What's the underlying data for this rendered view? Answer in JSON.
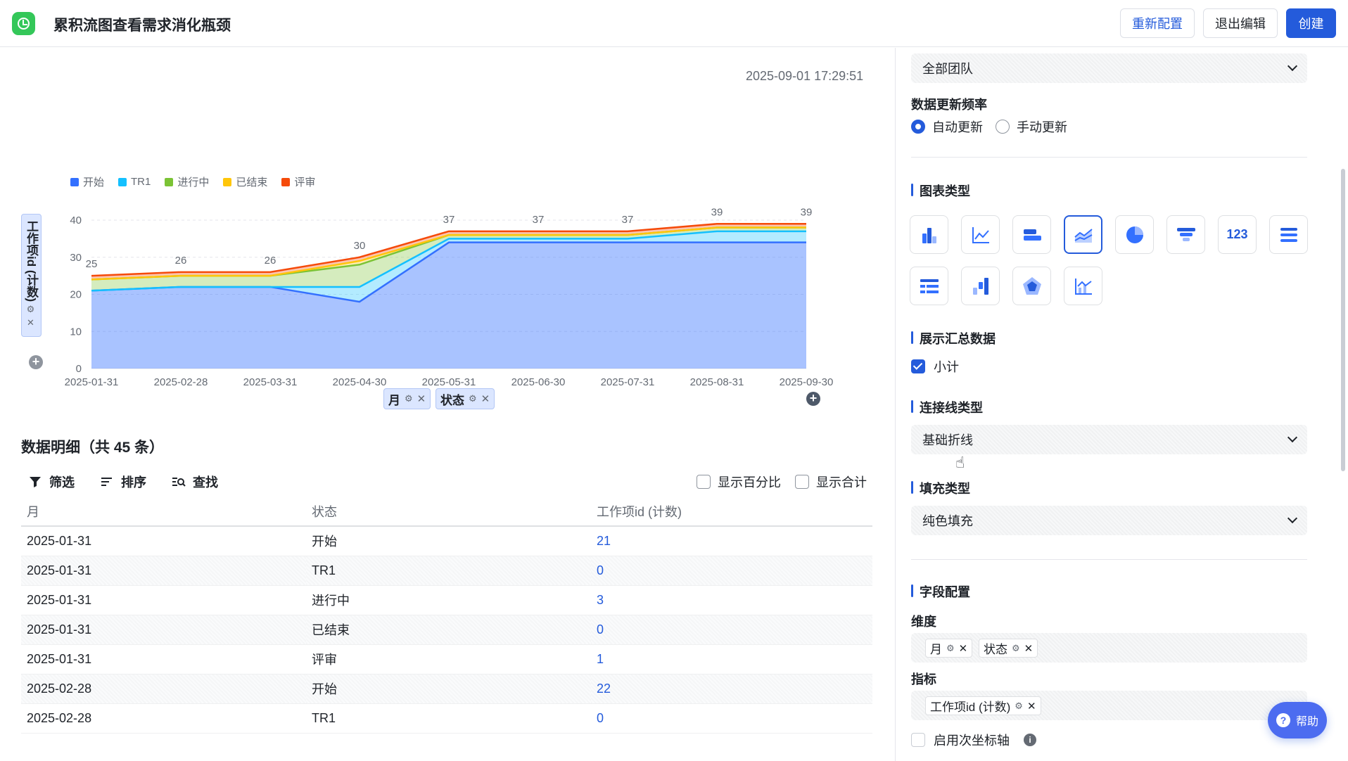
{
  "header": {
    "title": "累积流图查看需求消化瓶颈",
    "reconfig_label": "重新配置",
    "exit_label": "退出编辑",
    "create_label": "创建"
  },
  "main": {
    "timestamp": "2025-09-01 17:29:51",
    "yaxis_chip": "工作项id (计数)",
    "row_chips": [
      "月",
      "状态"
    ],
    "detail_title": "数据明细（共 45 条）",
    "toolbar": {
      "filter": "筛选",
      "sort": "排序",
      "find": "查找"
    },
    "show_percent": "显示百分比",
    "show_total": "显示合计",
    "table": {
      "headers": [
        "月",
        "状态",
        "工作项id (计数)"
      ],
      "rows": [
        [
          "2025-01-31",
          "开始",
          "21"
        ],
        [
          "2025-01-31",
          "TR1",
          "0"
        ],
        [
          "2025-01-31",
          "进行中",
          "3"
        ],
        [
          "2025-01-31",
          "已结束",
          "0"
        ],
        [
          "2025-01-31",
          "评审",
          "1"
        ],
        [
          "2025-02-28",
          "开始",
          "22"
        ],
        [
          "2025-02-28",
          "TR1",
          "0"
        ]
      ]
    }
  },
  "chart_data": {
    "type": "area",
    "stacked": true,
    "categories": [
      "2025-01-31",
      "2025-02-28",
      "2025-03-31",
      "2025-04-30",
      "2025-05-31",
      "2025-06-30",
      "2025-07-31",
      "2025-08-31",
      "2025-09-30"
    ],
    "series": [
      {
        "name": "开始",
        "color": "#3370ff",
        "values": [
          21,
          22,
          22,
          18,
          34,
          34,
          34,
          34,
          34
        ]
      },
      {
        "name": "TR1",
        "color": "#14c0ff",
        "values": [
          0,
          0,
          0,
          4,
          1,
          1,
          1,
          3,
          3
        ]
      },
      {
        "name": "进行中",
        "color": "#7bc335",
        "values": [
          3,
          3,
          3,
          6,
          1,
          1,
          1,
          1,
          1
        ]
      },
      {
        "name": "已结束",
        "color": "#ffc60a",
        "values": [
          0,
          0,
          0,
          1,
          0,
          0,
          0,
          0,
          0
        ]
      },
      {
        "name": "评审",
        "color": "#f54a0a",
        "values": [
          1,
          1,
          1,
          1,
          1,
          1,
          1,
          1,
          1
        ]
      }
    ],
    "totals": [
      "25",
      "26",
      "26",
      "30",
      "37",
      "37",
      "37",
      "39",
      "39"
    ],
    "yticks": [
      "0",
      "10",
      "20",
      "30",
      "40"
    ],
    "ylim": [
      0,
      40
    ],
    "legend": "top-left"
  },
  "panel": {
    "team_select": "全部团队",
    "update_freq_label": "数据更新频率",
    "auto_update": "自动更新",
    "manual_update": "手动更新",
    "chart_type_label": "图表类型",
    "show_summary_label": "展示汇总数据",
    "subtotal_label": "小计",
    "line_type_label": "连接线类型",
    "line_type_value": "基础折线",
    "fill_type_label": "填充类型",
    "fill_type_value": "纯色填充",
    "field_config_label": "字段配置",
    "dimension_label": "维度",
    "dimension_chips": [
      "月",
      "状态"
    ],
    "metric_label": "指标",
    "metric_chip": "工作项id (计数)",
    "secondary_axis_label": "启用次坐标轴",
    "number_icon_text": "123"
  },
  "help_label": "帮助",
  "colors": {
    "accent": "#245bdb",
    "logo": "#34c759"
  }
}
